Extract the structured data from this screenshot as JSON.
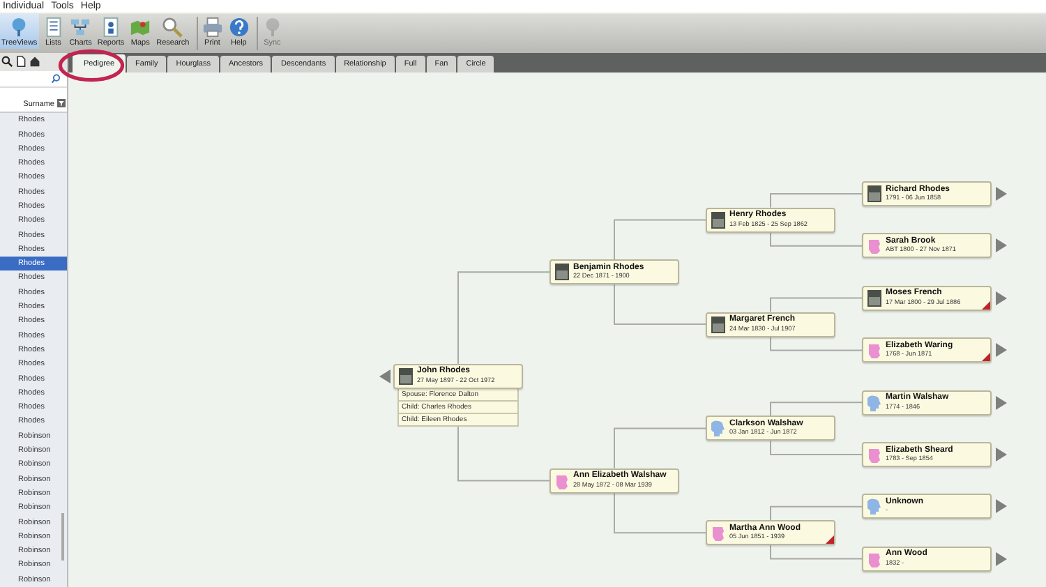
{
  "menu": [
    "Individual",
    "Tools",
    "Help"
  ],
  "toolbar": [
    {
      "label": "TreeViews",
      "selected": true,
      "disabled": false
    },
    {
      "label": "Lists",
      "selected": false,
      "disabled": false
    },
    {
      "label": "Charts",
      "selected": false,
      "disabled": false
    },
    {
      "label": "Reports",
      "selected": false,
      "disabled": false
    },
    {
      "label": "Maps",
      "selected": false,
      "disabled": false
    },
    {
      "label": "Research",
      "selected": false,
      "disabled": false
    },
    {
      "label": "Print",
      "selected": false,
      "disabled": false
    },
    {
      "label": "Help",
      "selected": false,
      "disabled": false
    },
    {
      "label": "Sync",
      "selected": false,
      "disabled": true
    }
  ],
  "tabs": [
    {
      "label": "Pedigree",
      "selected": true
    },
    {
      "label": "Family",
      "selected": false
    },
    {
      "label": "Hourglass",
      "selected": false
    },
    {
      "label": "Ancestors",
      "selected": false
    },
    {
      "label": "Descendants",
      "selected": false
    },
    {
      "label": "Relationship",
      "selected": false
    },
    {
      "label": "Full",
      "selected": false
    },
    {
      "label": "Fan",
      "selected": false
    },
    {
      "label": "Circle",
      "selected": false
    }
  ],
  "sidebar": {
    "column_header": "Surname",
    "rows": [
      {
        "surname": "Rhodes",
        "selected": false
      },
      {
        "surname": "Rhodes",
        "selected": false
      },
      {
        "surname": "Rhodes",
        "selected": false
      },
      {
        "surname": "Rhodes",
        "selected": false
      },
      {
        "surname": "Rhodes",
        "selected": false
      },
      {
        "surname": "Rhodes",
        "selected": false
      },
      {
        "surname": "Rhodes",
        "selected": false
      },
      {
        "surname": "Rhodes",
        "selected": false
      },
      {
        "surname": "Rhodes",
        "selected": false
      },
      {
        "surname": "Rhodes",
        "selected": false
      },
      {
        "surname": "Rhodes",
        "selected": true
      },
      {
        "surname": "Rhodes",
        "selected": false
      },
      {
        "surname": "Rhodes",
        "selected": false
      },
      {
        "surname": "Rhodes",
        "selected": false
      },
      {
        "surname": "Rhodes",
        "selected": false
      },
      {
        "surname": "Rhodes",
        "selected": false
      },
      {
        "surname": "Rhodes",
        "selected": false
      },
      {
        "surname": "Rhodes",
        "selected": false
      },
      {
        "surname": "Rhodes",
        "selected": false
      },
      {
        "surname": "Rhodes",
        "selected": false
      },
      {
        "surname": "Rhodes",
        "selected": false
      },
      {
        "surname": "Rhodes",
        "selected": false
      },
      {
        "surname": "Robinson",
        "selected": false
      },
      {
        "surname": "Robinson",
        "selected": false
      },
      {
        "surname": "Robinson",
        "selected": false
      },
      {
        "surname": "Robinson",
        "selected": false
      },
      {
        "surname": "Robinson",
        "selected": false
      },
      {
        "surname": "Robinson",
        "selected": false
      },
      {
        "surname": "Robinson",
        "selected": false
      },
      {
        "surname": "Robinson",
        "selected": false
      },
      {
        "surname": "Robinson",
        "selected": false
      },
      {
        "surname": "Robinson",
        "selected": false
      },
      {
        "surname": "Robinson",
        "selected": false
      }
    ]
  },
  "pedigree": {
    "name": "John Rhodes",
    "dates": "27 May 1897 - 22 Oct 1972",
    "kind": "photo",
    "flagged": false,
    "more": true,
    "details": [
      "Spouse: Florence Dalton",
      "Child: Charles Rhodes",
      "Child: Eileen Rhodes"
    ],
    "parents": [
      {
        "name": "Benjamin Rhodes",
        "dates": "22 Dec 1871 - 1900",
        "kind": "photo",
        "flagged": false,
        "more": false,
        "parents": [
          {
            "name": "Henry Rhodes",
            "dates": "13 Feb 1825 - 25 Sep 1862",
            "kind": "photo",
            "flagged": false,
            "more": false,
            "parents": [
              {
                "name": "Richard Rhodes",
                "dates": "1791 - 06 Jun 1858",
                "kind": "photo",
                "flagged": false,
                "more": true
              },
              {
                "name": "Sarah Brook",
                "dates": "ABT 1800 - 27 Nov 1871",
                "kind": "female",
                "flagged": false,
                "more": true
              }
            ]
          },
          {
            "name": "Margaret French",
            "dates": "24 Mar 1830 - Jul 1907",
            "kind": "photo",
            "flagged": false,
            "more": false,
            "parents": [
              {
                "name": "Moses French",
                "dates": "17 Mar 1800 - 29 Jul 1886",
                "kind": "photo",
                "flagged": true,
                "more": true
              },
              {
                "name": "Elizabeth Waring",
                "dates": "1768 - Jun 1871",
                "kind": "female",
                "flagged": true,
                "more": true
              }
            ]
          }
        ]
      },
      {
        "name": "Ann Elizabeth Walshaw",
        "dates": "28 May 1872 - 08 Mar 1939",
        "kind": "female",
        "flagged": false,
        "more": false,
        "parents": [
          {
            "name": "Clarkson Walshaw",
            "dates": "03 Jan 1812 - Jun 1872",
            "kind": "male",
            "flagged": false,
            "more": false,
            "parents": [
              {
                "name": "Martin Walshaw",
                "dates": "1774 - 1846",
                "kind": "male",
                "flagged": false,
                "more": true
              },
              {
                "name": "Elizabeth Sheard",
                "dates": "1783 - Sep 1854",
                "kind": "female",
                "flagged": false,
                "more": true
              }
            ]
          },
          {
            "name": "Martha Ann Wood",
            "dates": "05 Jun 1851 - 1939",
            "kind": "female",
            "flagged": true,
            "more": false,
            "parents": [
              {
                "name": "Unknown",
                "dates": "-",
                "kind": "male",
                "flagged": false,
                "more": true
              },
              {
                "name": "Ann Wood",
                "dates": "1832 -",
                "kind": "female",
                "flagged": false,
                "more": true
              }
            ]
          }
        ]
      }
    ]
  }
}
